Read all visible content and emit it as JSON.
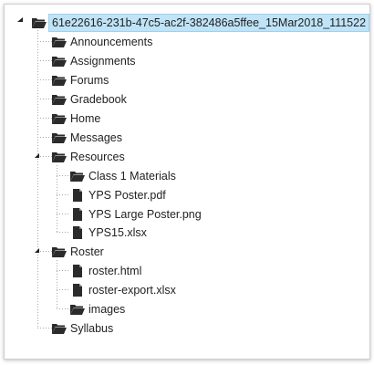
{
  "tree": {
    "root": {
      "label": "61e22616-231b-47c5-ac2f-382486a5ffee_15Mar2018_111522",
      "icon": "folder-open-icon",
      "expanded": true
    },
    "items": [
      {
        "label": "Announcements",
        "icon": "folder-icon"
      },
      {
        "label": "Assignments",
        "icon": "folder-icon"
      },
      {
        "label": "Forums",
        "icon": "folder-icon"
      },
      {
        "label": "Gradebook",
        "icon": "folder-icon"
      },
      {
        "label": "Home",
        "icon": "folder-icon"
      },
      {
        "label": "Messages",
        "icon": "folder-icon"
      },
      {
        "label": "Resources",
        "icon": "folder-open-icon",
        "expanded": true,
        "children": [
          {
            "label": "Class 1 Materials",
            "icon": "folder-icon"
          },
          {
            "label": "YPS Poster.pdf",
            "icon": "file-icon"
          },
          {
            "label": "YPS Large Poster.png",
            "icon": "file-icon"
          },
          {
            "label": "YPS15.xlsx",
            "icon": "file-icon"
          }
        ]
      },
      {
        "label": "Roster",
        "icon": "folder-open-icon",
        "expanded": true,
        "children": [
          {
            "label": "roster.html",
            "icon": "file-icon"
          },
          {
            "label": "roster-export.xlsx",
            "icon": "file-icon"
          },
          {
            "label": "images",
            "icon": "folder-icon"
          }
        ]
      },
      {
        "label": "Syllabus",
        "icon": "folder-icon"
      }
    ]
  },
  "colors": {
    "selection": "#bfe3f7",
    "folder": "#2b2b2b",
    "guide": "#9a9a9a"
  }
}
